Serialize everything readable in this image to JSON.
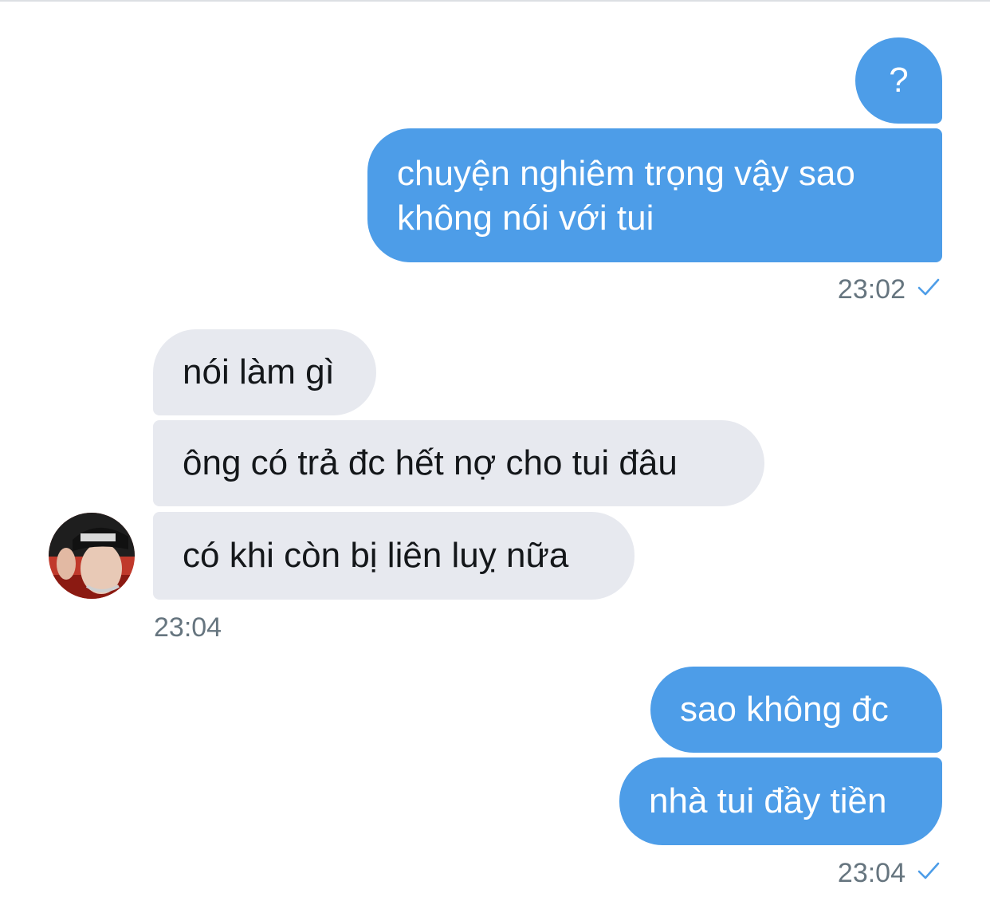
{
  "conversation": {
    "messages": [
      {
        "id": "m1",
        "direction": "sent",
        "text": "?"
      },
      {
        "id": "m2",
        "direction": "sent",
        "lines": [
          "chuyện nghiêm trọng vậy sao",
          "không nói với tui"
        ]
      },
      {
        "id": "m3",
        "direction": "received",
        "text": "nói làm gì"
      },
      {
        "id": "m4",
        "direction": "received",
        "text": "ông có trả đc hết nợ cho tui đâu"
      },
      {
        "id": "m5",
        "direction": "received",
        "text": "có khi còn bị liên luỵ nữa"
      },
      {
        "id": "m6",
        "direction": "sent",
        "text": "sao không đc"
      },
      {
        "id": "m7",
        "direction": "sent",
        "text": "nhà tui đầy tiền"
      }
    ],
    "timestamps": {
      "sent_group_1": "23:02",
      "received_group": "23:04",
      "sent_group_2": "23:04"
    },
    "read_receipt_icon": "checkmark-icon",
    "avatar_icon": "contact-avatar"
  },
  "colors": {
    "sent_bubble": "#4d9de8",
    "received_bubble": "#e7e9ef",
    "timestamp_text": "#66757f",
    "check": "#4d9de8"
  }
}
